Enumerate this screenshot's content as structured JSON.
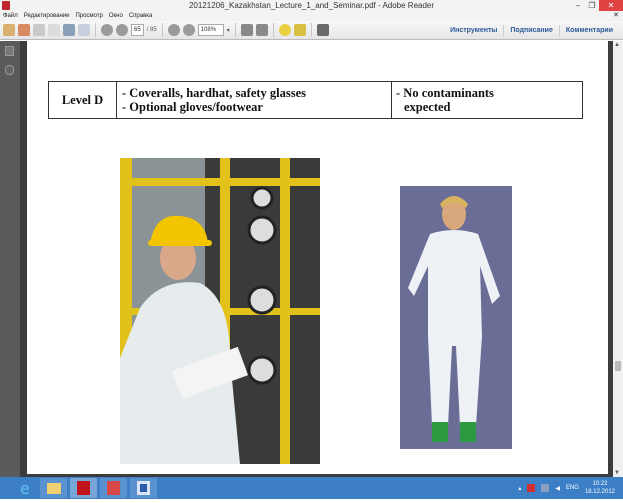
{
  "window": {
    "title": "20121206_Kazakhstan_Lecture_1_and_Seminar.pdf - Adobe Reader",
    "minimize": "–",
    "maximize": "❐",
    "close": "✕"
  },
  "menu": {
    "items": [
      "Файл",
      "Редактирование",
      "Просмотр",
      "Окно",
      "Справка"
    ],
    "close": "✕"
  },
  "toolbar": {
    "page_current": "65",
    "page_total": "/ 85",
    "zoom": "108%",
    "zoom_arrow": "▾",
    "right_tabs": [
      "Инструменты",
      "Подписание",
      "Комментарии"
    ]
  },
  "document": {
    "table": {
      "level": "Level D",
      "equipment": [
        "- Coveralls, hardhat, safety glasses",
        "- Optional gloves/footwear"
      ],
      "notes": [
        "- No contaminants",
        "expected"
      ]
    }
  },
  "taskbar": {
    "tray": {
      "lang": "ENG",
      "time": "10:22",
      "date": "18.12.2012"
    }
  },
  "colors": {
    "accent": "#2c5a9a",
    "taskbar": "#3c7fc6",
    "hardhat": "#f2c500"
  }
}
